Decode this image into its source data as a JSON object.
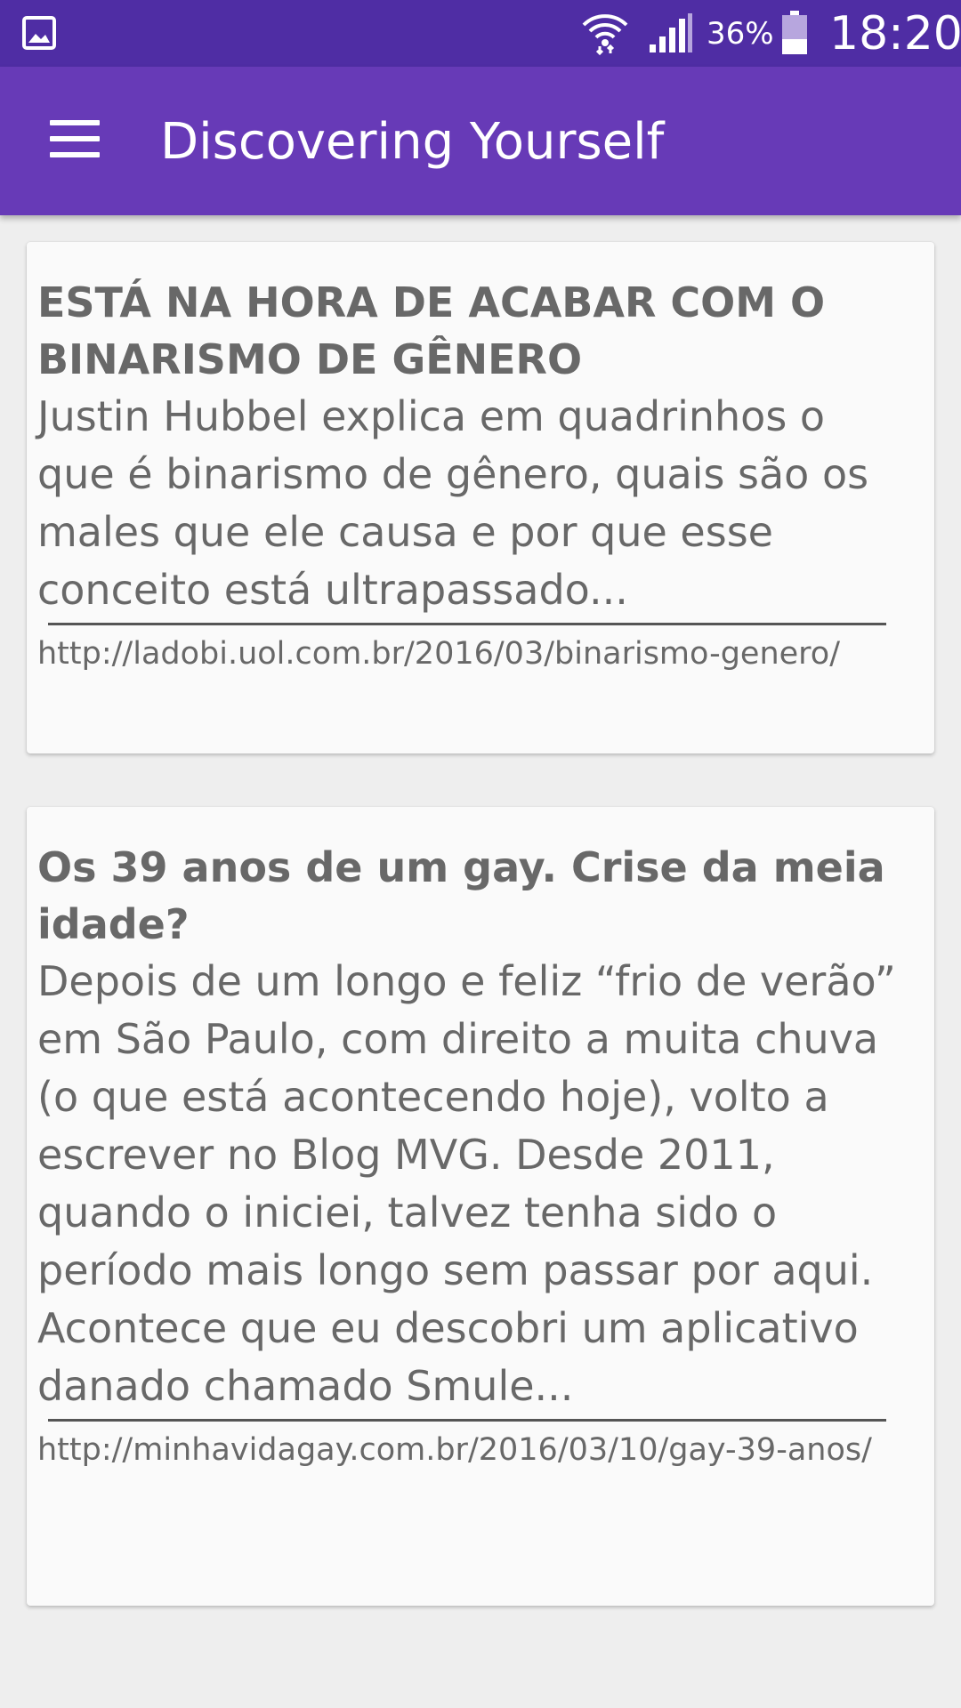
{
  "status_bar": {
    "battery_percent": "36%",
    "time": "18:20",
    "icons": [
      "gallery-icon",
      "wifi-icon",
      "signal-icon",
      "battery-icon"
    ]
  },
  "app_bar": {
    "title": "Discovering Yourself",
    "menu_icon": "hamburger-menu-icon",
    "background_color": "#673ab7",
    "status_color": "#4f2da4"
  },
  "articles": [
    {
      "title": "ESTÁ NA HORA DE ACABAR COM O BINARISMO DE GÊNERO",
      "summary": "Justin Hubbel explica em quadrinhos o que é binarismo de gênero, quais são os males que ele causa e por que esse conceito está ultrapassado...",
      "link": "http://ladobi.uol.com.br/2016/03/binarismo-genero/"
    },
    {
      "title": "Os 39 anos de um gay. Crise da meia idade?",
      "summary": "Depois de um longo e feliz “frio de verão” em São Paulo, com direito a muita chuva (o que está acontecendo hoje), volto a escrever no Blog MVG. Desde 2011, quando o iniciei, talvez tenha sido o período mais longo sem passar por aqui. Acontece que eu descobri um aplicativo danado chamado Smule...",
      "link": "http://minhavidagay.com.br/2016/03/10/gay-39-anos/"
    }
  ]
}
